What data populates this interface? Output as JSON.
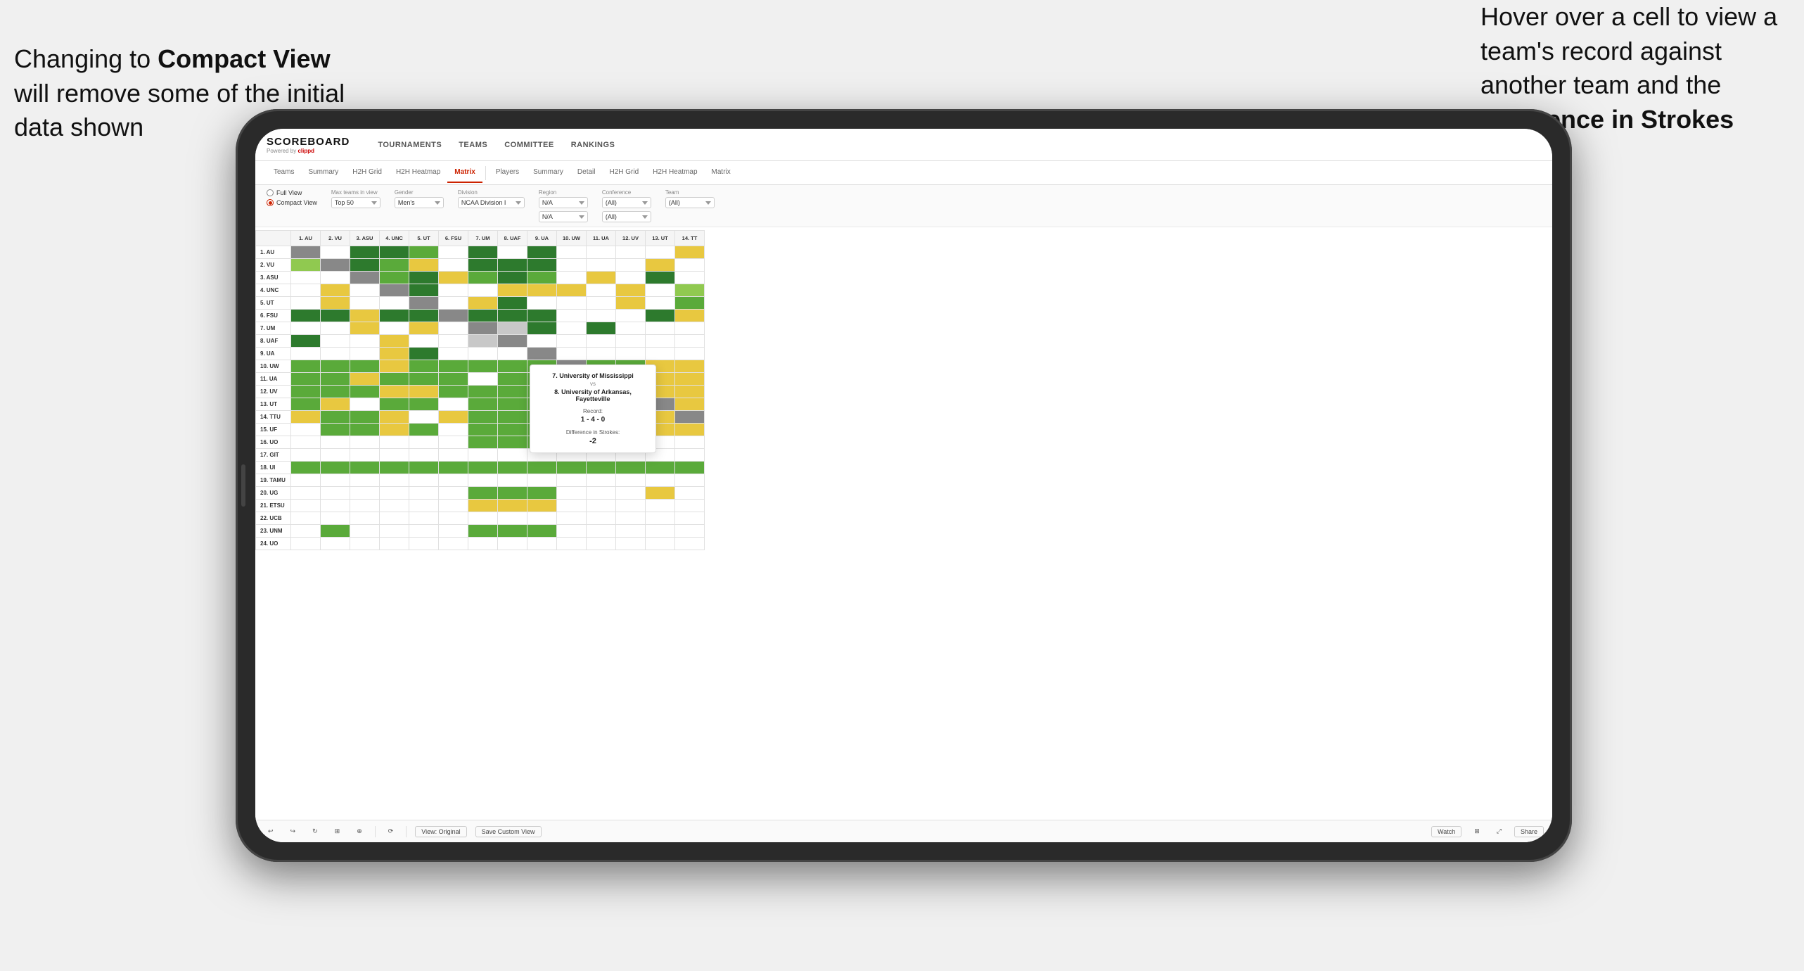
{
  "annotations": {
    "left_text": "Changing to Compact View will remove some of the initial data shown",
    "left_bold": "Compact View",
    "right_text": "Hover over a cell to view a team's record against another team and the Difference in Strokes",
    "right_bold": "Difference in Strokes"
  },
  "app": {
    "logo": "SCOREBOARD",
    "logo_sub": "Powered by clippd",
    "nav": [
      "TOURNAMENTS",
      "TEAMS",
      "COMMITTEE",
      "RANKINGS"
    ],
    "sub_nav_left": [
      "Teams",
      "Summary",
      "H2H Grid",
      "H2H Heatmap",
      "Matrix"
    ],
    "sub_nav_right": [
      "Players",
      "Summary",
      "Detail",
      "H2H Grid",
      "H2H Heatmap",
      "Matrix"
    ],
    "active_tab": "Matrix",
    "view_options": {
      "full_view": "Full View",
      "compact_view": "Compact View",
      "selected": "compact"
    },
    "filters": {
      "max_teams_label": "Max teams in view",
      "max_teams_value": "Top 50",
      "gender_label": "Gender",
      "gender_value": "Men's",
      "division_label": "Division",
      "division_value": "NCAA Division I",
      "region_label": "Region",
      "region_value": "N/A",
      "region_value2": "N/A",
      "conference_label": "Conference",
      "conference_value": "(All)",
      "conference_value2": "(All)",
      "team_label": "Team",
      "team_value": "(All)"
    },
    "col_headers": [
      "1. AU",
      "2. VU",
      "3. ASU",
      "4. UNC",
      "5. UT",
      "6. FSU",
      "7. UM",
      "8. UAF",
      "9. UA",
      "10. UW",
      "11. UA",
      "12. UV",
      "13. UT",
      "14. TT"
    ],
    "row_headers": [
      "1. AU",
      "2. VU",
      "3. ASU",
      "4. UNC",
      "5. UT",
      "6. FSU",
      "7. UM",
      "8. UAF",
      "9. UA",
      "10. UW",
      "11. UA",
      "12. UV",
      "13. UT",
      "14. TTU",
      "15. UF",
      "16. UO",
      "17. GIT",
      "18. UI",
      "19. TAMU",
      "20. UG",
      "21. ETSU",
      "22. UCB",
      "23. UNM",
      "24. UO"
    ],
    "tooltip": {
      "team1": "7. University of Mississippi",
      "vs": "vs",
      "team2": "8. University of Arkansas, Fayetteville",
      "record_label": "Record:",
      "record": "1 - 4 - 0",
      "strokes_label": "Difference in Strokes:",
      "strokes": "-2"
    },
    "toolbar": {
      "view_original": "View: Original",
      "save_custom": "Save Custom View",
      "watch": "Watch",
      "share": "Share"
    }
  }
}
